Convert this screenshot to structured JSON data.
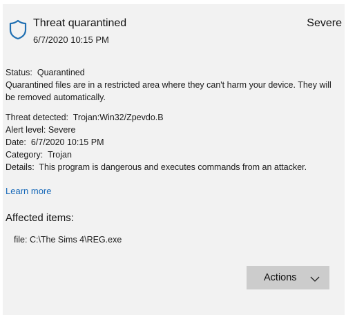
{
  "header": {
    "title": "Threat quarantined",
    "severity": "Severe",
    "date": "6/7/2020 10:15 PM",
    "icon": "shield-icon"
  },
  "status": {
    "label": "Status:",
    "value": "Quarantined",
    "description": "Quarantined files are in a restricted area where they can't harm your device. They will be removed automatically."
  },
  "details": {
    "threat_label": "Threat detected:",
    "threat_value": "Trojan:Win32/Zpevdo.B",
    "alert_label": "Alert level:",
    "alert_value": "Severe",
    "date_label": "Date:",
    "date_value": "6/7/2020 10:15 PM",
    "category_label": "Category:",
    "category_value": "Trojan",
    "details_label": "Details:",
    "details_value": "This program is dangerous and executes commands from an attacker."
  },
  "learn_more": "Learn more",
  "affected": {
    "title": "Affected items:",
    "items": [
      {
        "type": "file:",
        "path": "C:\\The Sims 4\\REG.exe"
      }
    ]
  },
  "actions_button": {
    "label": "Actions",
    "icon": "chevron-down-icon"
  },
  "colors": {
    "panel_bg": "#f2f2f2",
    "link": "#1668b8",
    "button_bg": "#cccccc",
    "shield": "#1f6fb2"
  }
}
